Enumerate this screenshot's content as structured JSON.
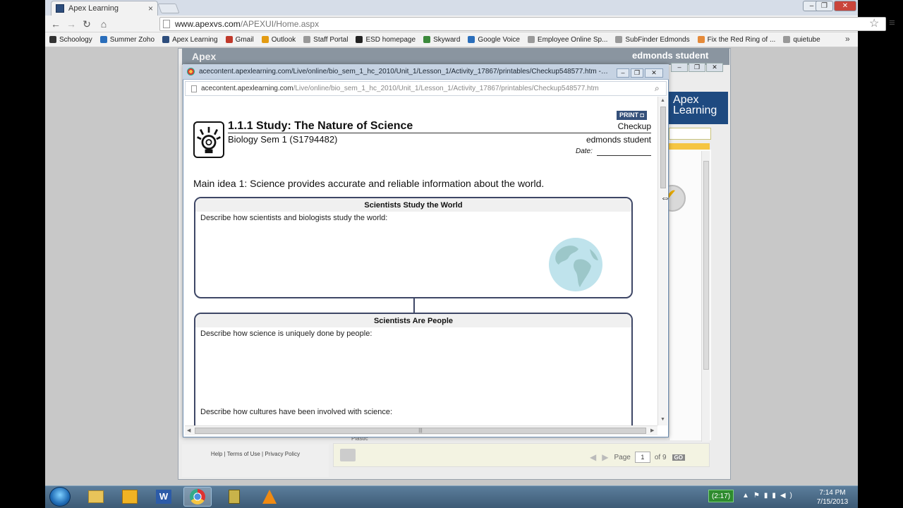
{
  "chrome": {
    "tab_title": "Apex Learning",
    "tab_close": "×",
    "url_host": "www.apexvs.com",
    "url_path": "/APEXUI/Home.aspx",
    "window_controls": [
      "–",
      "❐",
      "✕"
    ],
    "bookmarks": [
      {
        "label": "Schoology",
        "icon": "schoology-icon",
        "color": "#333333"
      },
      {
        "label": "Summer Zoho",
        "icon": "folder-icon",
        "color": "#2a6ebb"
      },
      {
        "label": "Apex Learning",
        "icon": "apex-icon",
        "color": "#2d4d7c"
      },
      {
        "label": "Gmail",
        "icon": "gmail-icon",
        "color": "#c0392b"
      },
      {
        "label": "Outlook",
        "icon": "outlook-icon",
        "color": "#e39b12"
      },
      {
        "label": "Staff Portal",
        "icon": "page-icon",
        "color": "#999999"
      },
      {
        "label": "ESD homepage",
        "icon": "esd-icon",
        "color": "#222222"
      },
      {
        "label": "Skyward",
        "icon": "skyward-icon",
        "color": "#3c8a3c"
      },
      {
        "label": "Google Voice",
        "icon": "voice-icon",
        "color": "#2a6ebb"
      },
      {
        "label": "Employee Online Sp...",
        "icon": "page-icon",
        "color": "#999999"
      },
      {
        "label": "SubFinder Edmonds",
        "icon": "page-icon",
        "color": "#999999"
      },
      {
        "label": "Fix the Red Ring of ...",
        "icon": "fix-icon",
        "color": "#e58a3a"
      },
      {
        "label": "quietube",
        "icon": "page-icon",
        "color": "#999999"
      }
    ],
    "bookmarks_more": "»"
  },
  "apex": {
    "logo_text": "Apex",
    "user_name": "edmonds student",
    "logo_box_line1": "Apex",
    "logo_box_line2": "Learning",
    "footer_links": "Help  |  Terms of Use  |  Privacy Policy",
    "plastic_label": "Plastic",
    "pager": {
      "page_label": "Page",
      "page_value": "1",
      "of_label": "of 9",
      "go_label": "GO"
    }
  },
  "popup": {
    "title": "acecontent.apexlearning.com/Live/online/bio_sem_1_hc_2010/Unit_1/Lesson_1/Activity_17867/printables/Checkup548577.htm - Google ...",
    "address_host": "acecontent.apexlearning.com",
    "address_path": "/Live/online/bio_sem_1_hc_2010/Unit_1/Lesson_1/Activity_17867/printables/Checkup548577.htm",
    "controls": [
      "–",
      "❐",
      "✕"
    ]
  },
  "document": {
    "print_label": "PRINT",
    "lesson_title": "1.1.1 Study: The Nature of Science",
    "activity_type": "Checkup",
    "course": "Biology Sem 1 (S1794482)",
    "student": "edmonds student",
    "date_label": "Date:",
    "main_idea": "Main idea 1: Science provides accurate and reliable information about the world.",
    "box1": {
      "heading": "Scientists Study the World",
      "prompt": "Describe how scientists and biologists study the world:"
    },
    "box2": {
      "heading": "Scientists Are People",
      "prompt1": "Describe how science is uniquely done by people:",
      "prompt2": "Describe how cultures have been involved with science:"
    }
  },
  "taskbar": {
    "battery": "(2:17)",
    "time": "7:14 PM",
    "date": "7/15/2013",
    "apps": [
      "start-orb",
      "explorer-icon",
      "outlook-icon",
      "word-icon",
      "chrome-icon",
      "stamp-icon",
      "vlc-icon"
    ]
  }
}
